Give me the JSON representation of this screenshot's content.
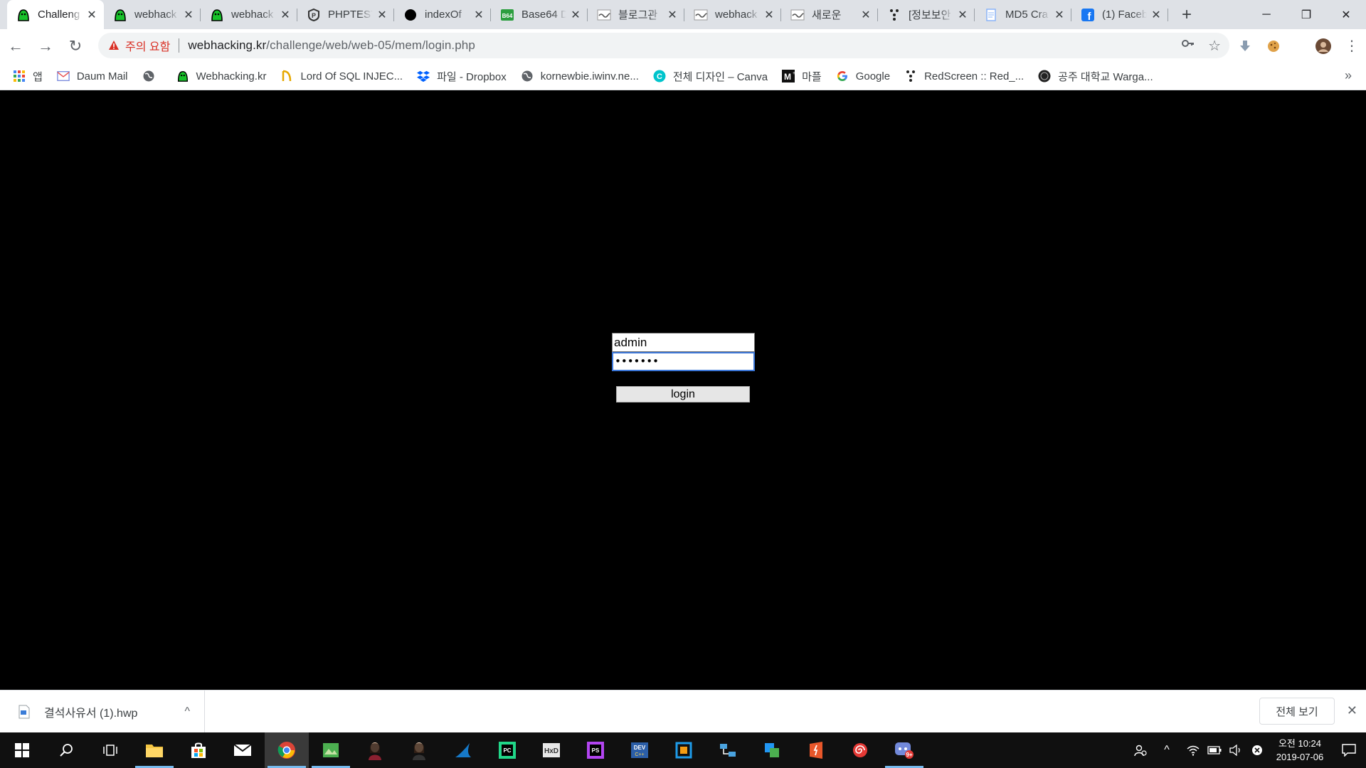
{
  "tabs": [
    {
      "title": "Challeng",
      "icon": "webhacking-icon",
      "active": true
    },
    {
      "title": "webhack",
      "icon": "webhacking-icon"
    },
    {
      "title": "webhack",
      "icon": "webhacking-icon"
    },
    {
      "title": "PHPTEST",
      "icon": "phptester-icon"
    },
    {
      "title": "indexOf",
      "icon": "black-circle-icon"
    },
    {
      "title": "Base64 D",
      "icon": "base64-icon"
    },
    {
      "title": "블로그관",
      "icon": "blog-icon"
    },
    {
      "title": "webhack",
      "icon": "blog-icon"
    },
    {
      "title": "새로운 ",
      "icon": "blog-icon"
    },
    {
      "title": "[정보보안",
      "icon": "dots-icon"
    },
    {
      "title": "MD5 Cra",
      "icon": "doc-icon"
    },
    {
      "title": "(1) Faceb",
      "icon": "facebook-icon"
    }
  ],
  "omnibox": {
    "warning": "주의 요함",
    "url_host": "webhacking.kr",
    "url_path": "/challenge/web/web-05/mem/login.php"
  },
  "bookmarks": [
    {
      "label": "앱",
      "icon": "apps-grid-icon"
    },
    {
      "label": "Daum Mail",
      "icon": "mail-icon"
    },
    {
      "label": "",
      "icon": "globe-icon"
    },
    {
      "label": "Webhacking.kr",
      "icon": "webhacking-icon"
    },
    {
      "label": "Lord Of SQL INJEC...",
      "icon": "lord-icon"
    },
    {
      "label": "파일 - Dropbox",
      "icon": "dropbox-icon"
    },
    {
      "label": "kornewbie.iwinv.ne...",
      "icon": "globe-icon"
    },
    {
      "label": "전체 디자인 – Canva",
      "icon": "canva-icon"
    },
    {
      "label": "마플",
      "icon": "marple-icon"
    },
    {
      "label": "Google",
      "icon": "google-icon"
    },
    {
      "label": "RedScreen :: Red_...",
      "icon": "dots-icon"
    },
    {
      "label": "공주 대학교 Warga...",
      "icon": "kongju-icon"
    }
  ],
  "login": {
    "id_value": "admin",
    "pw_value": "•••••••",
    "button_label": "login"
  },
  "download": {
    "file": "결석사유서 (1).hwp",
    "show_all": "전체 보기"
  },
  "clock": {
    "time": "오전 10:24",
    "date": "2019-07-06"
  },
  "colors": {
    "page_bg": "#000000",
    "focus_border": "#3b76d8",
    "warning": "#d93025"
  }
}
